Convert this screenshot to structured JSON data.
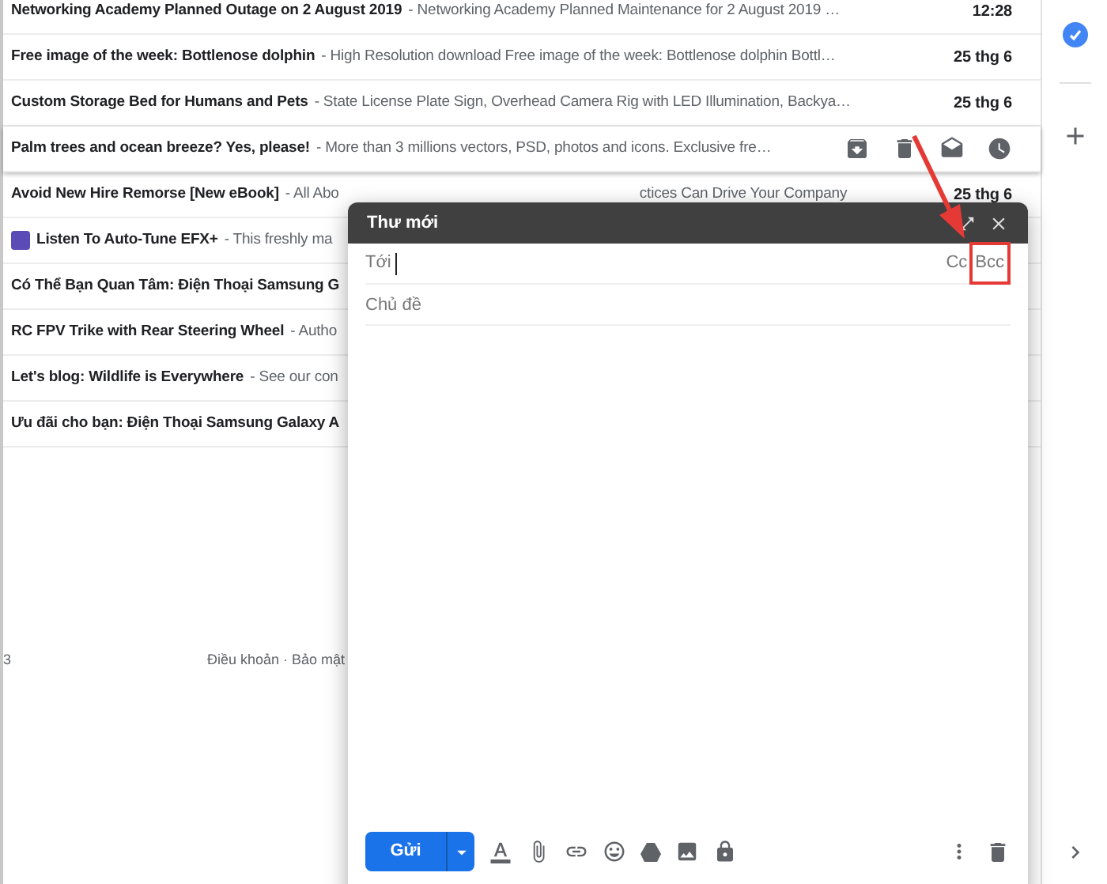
{
  "emails": [
    {
      "subject": "Networking Academy Planned Outage on 2 August 2019",
      "snippet": "- Networking Academy Planned Maintenance for 2 August 2019 …",
      "date": "12:28",
      "hovered": false,
      "has_icon": false
    },
    {
      "subject": "Free image of the week: Bottlenose dolphin",
      "snippet": "- High Resolution download Free image of the week: Bottlenose dolphin Bottl…",
      "date": "25 thg 6",
      "hovered": false,
      "has_icon": false
    },
    {
      "subject": "Custom Storage Bed for Humans and Pets",
      "snippet": "- State License Plate Sign, Overhead Camera Rig with LED Illumination, Backya…",
      "date": "25 thg 6",
      "hovered": false,
      "has_icon": false
    },
    {
      "subject": "Palm trees and ocean breeze? Yes, please!",
      "snippet": "- More than 3 millions vectors, PSD, photos and icons. Exclusive fre…",
      "hovered": true,
      "has_icon": false
    },
    {
      "subject": "Avoid New Hire Remorse [New eBook]",
      "snippet": "- All Abo",
      "snippet_tail": "ctices Can Drive Your Company",
      "date": "25 thg 6",
      "hovered": false,
      "has_icon": false
    },
    {
      "subject": "Listen To Auto-Tune EFX+",
      "snippet": "- This freshly ma",
      "hovered": false,
      "has_icon": true
    },
    {
      "subject": "Có Thể Bạn Quan Tâm: Điện Thoại Samsung G",
      "hovered": false,
      "has_icon": false
    },
    {
      "subject": "RC FPV Trike with Rear Steering Wheel",
      "snippet": "- Autho",
      "hovered": false,
      "has_icon": false
    },
    {
      "subject": "Let's blog: Wildlife is Everywhere",
      "snippet": "- See our con",
      "hovered": false,
      "has_icon": false
    },
    {
      "subject": "Ưu đãi cho bạn: Điện Thoại Samsung Galaxy A",
      "hovered": false,
      "has_icon": false
    }
  ],
  "footer": {
    "storage": "3",
    "links": "Điều khoản · Bảo mật"
  },
  "compose": {
    "title": "Thư mới",
    "to_label": "Tới",
    "cc": "Cc",
    "bcc": "Bcc",
    "bcc_highlighted": true,
    "subject_placeholder": "Chủ đề",
    "send": "Gửi"
  }
}
